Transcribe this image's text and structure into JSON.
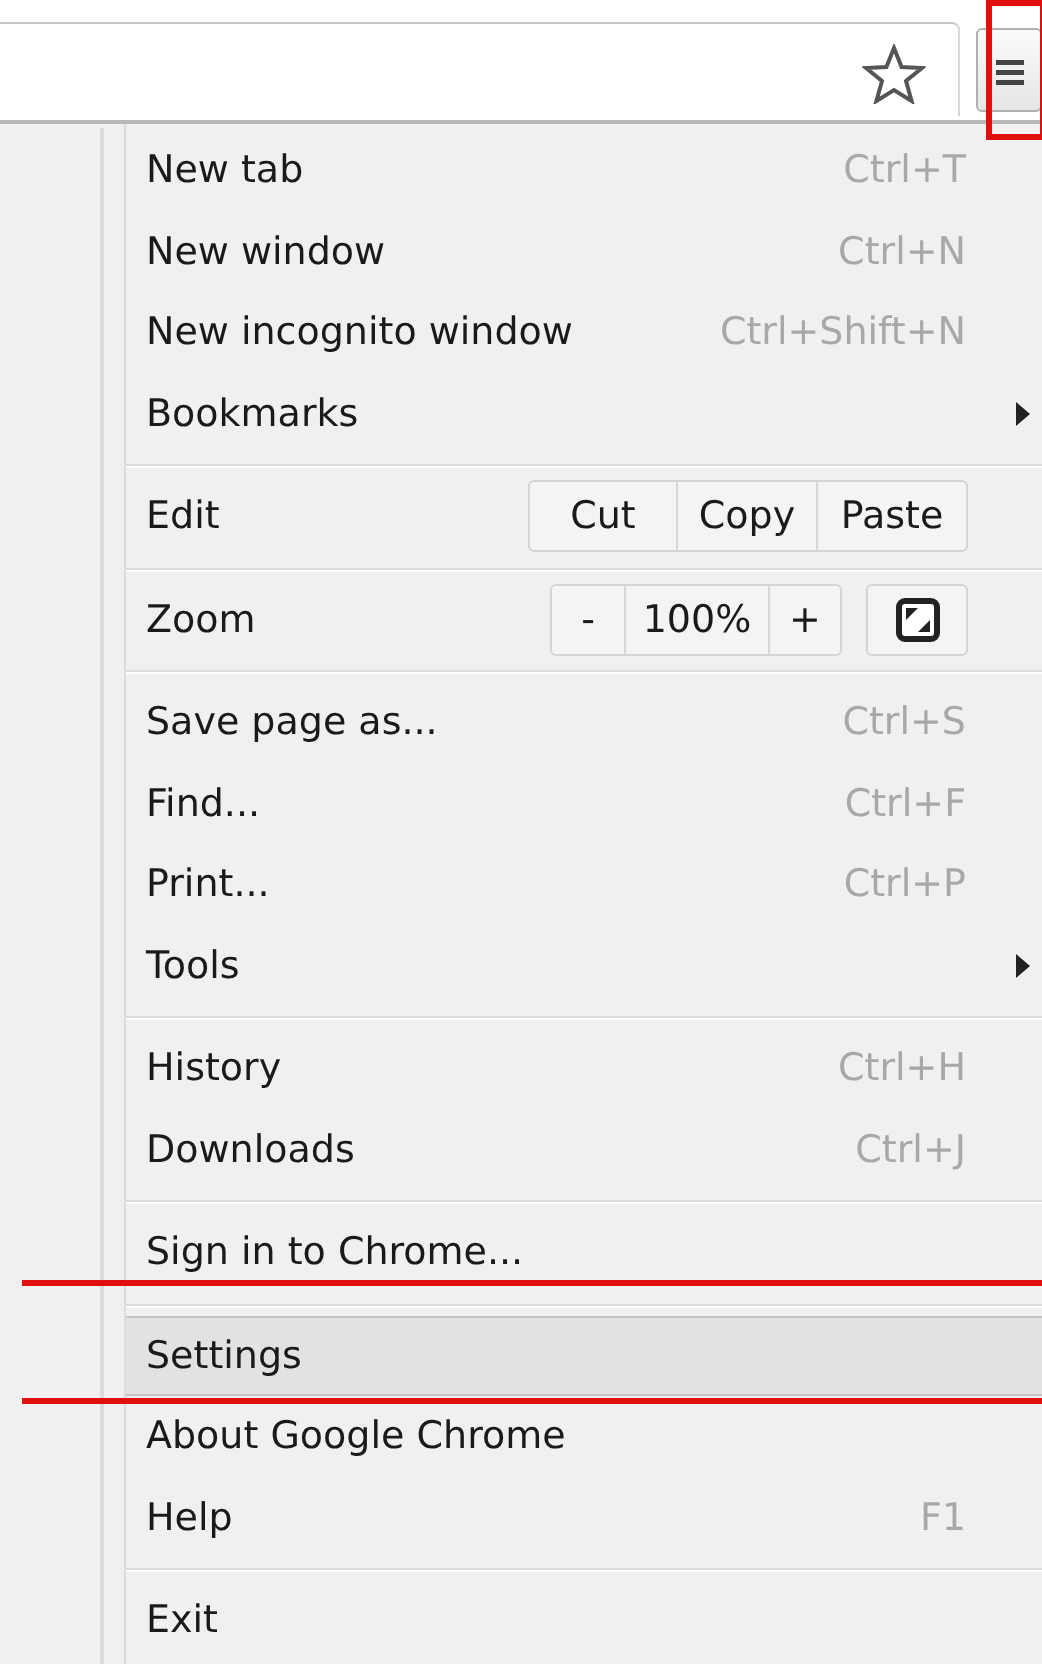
{
  "toolbar": {
    "menu_button": {
      "annotated": true
    }
  },
  "menu": {
    "sections": [
      [
        {
          "kind": "item",
          "label": "New tab",
          "shortcut": "Ctrl+T",
          "submenu": false,
          "selected": false,
          "annotated": false
        },
        {
          "kind": "item",
          "label": "New window",
          "shortcut": "Ctrl+N",
          "submenu": false,
          "selected": false,
          "annotated": false
        },
        {
          "kind": "item",
          "label": "New incognito window",
          "shortcut": "Ctrl+Shift+N",
          "submenu": false,
          "selected": false,
          "annotated": false
        },
        {
          "kind": "item",
          "label": "Bookmarks",
          "submenu": true,
          "selected": false,
          "annotated": false
        }
      ],
      [
        {
          "kind": "edit",
          "label": "Edit",
          "buttons": [
            "Cut",
            "Copy",
            "Paste"
          ]
        }
      ],
      [
        {
          "kind": "zoom",
          "label": "Zoom",
          "buttons": [
            "-",
            "100%",
            "+"
          ]
        }
      ],
      [
        {
          "kind": "item",
          "label": "Save page as...",
          "shortcut": "Ctrl+S",
          "submenu": false,
          "selected": false,
          "annotated": false
        },
        {
          "kind": "item",
          "label": "Find...",
          "shortcut": "Ctrl+F",
          "submenu": false,
          "selected": false,
          "annotated": false
        },
        {
          "kind": "item",
          "label": "Print...",
          "shortcut": "Ctrl+P",
          "submenu": false,
          "selected": false,
          "annotated": false
        },
        {
          "kind": "item",
          "label": "Tools",
          "submenu": true,
          "selected": false,
          "annotated": false
        }
      ],
      [
        {
          "kind": "item",
          "label": "History",
          "shortcut": "Ctrl+H",
          "submenu": false,
          "selected": false,
          "annotated": false
        },
        {
          "kind": "item",
          "label": "Downloads",
          "shortcut": "Ctrl+J",
          "submenu": false,
          "selected": false,
          "annotated": false
        }
      ],
      [
        {
          "kind": "item",
          "label": "Sign in to Chrome...",
          "submenu": false,
          "selected": false,
          "annotated": false
        }
      ],
      [
        {
          "kind": "item",
          "label": "Settings",
          "submenu": false,
          "selected": true,
          "annotated": true
        },
        {
          "kind": "item",
          "label": "About Google Chrome",
          "submenu": false,
          "selected": false,
          "annotated": false
        },
        {
          "kind": "item",
          "label": "Help",
          "shortcut": "F1",
          "submenu": false,
          "selected": false,
          "annotated": false
        }
      ],
      [
        {
          "kind": "item",
          "label": "Exit",
          "submenu": false,
          "selected": false,
          "annotated": false
        }
      ]
    ]
  }
}
